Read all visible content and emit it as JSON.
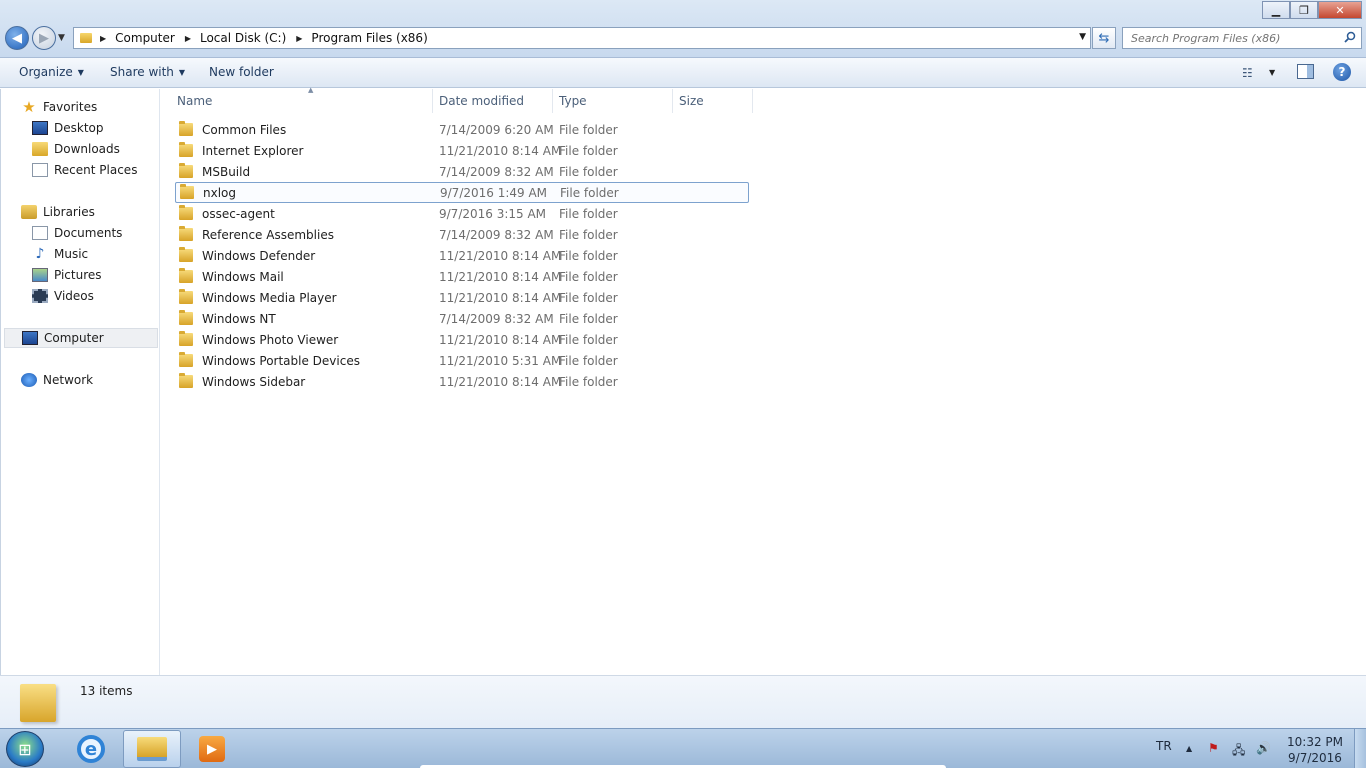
{
  "window": {
    "minimize_label": "▁",
    "maximize_label": "❐",
    "close_label": "✕"
  },
  "address": {
    "crumbs": [
      "Computer",
      "Local Disk (C:)",
      "Program Files (x86)"
    ]
  },
  "search": {
    "placeholder": "Search Program Files (x86)"
  },
  "commands": {
    "organize": "Organize",
    "share_with": "Share with",
    "new_folder": "New folder"
  },
  "sidebar": {
    "favorites": "Favorites",
    "desktop": "Desktop",
    "downloads": "Downloads",
    "recent_places": "Recent Places",
    "libraries": "Libraries",
    "documents": "Documents",
    "music": "Music",
    "pictures": "Pictures",
    "videos": "Videos",
    "computer": "Computer",
    "network": "Network"
  },
  "columns": {
    "name": "Name",
    "date_modified": "Date modified",
    "type": "Type",
    "size": "Size"
  },
  "files": [
    {
      "name": "Common Files",
      "date": "7/14/2009 6:20 AM",
      "type": "File folder"
    },
    {
      "name": "Internet Explorer",
      "date": "11/21/2010 8:14 AM",
      "type": "File folder"
    },
    {
      "name": "MSBuild",
      "date": "7/14/2009 8:32 AM",
      "type": "File folder"
    },
    {
      "name": "nxlog",
      "date": "9/7/2016 1:49 AM",
      "type": "File folder"
    },
    {
      "name": "ossec-agent",
      "date": "9/7/2016 3:15 AM",
      "type": "File folder"
    },
    {
      "name": "Reference Assemblies",
      "date": "7/14/2009 8:32 AM",
      "type": "File folder"
    },
    {
      "name": "Windows Defender",
      "date": "11/21/2010 8:14 AM",
      "type": "File folder"
    },
    {
      "name": "Windows Mail",
      "date": "11/21/2010 8:14 AM",
      "type": "File folder"
    },
    {
      "name": "Windows Media Player",
      "date": "11/21/2010 8:14 AM",
      "type": "File folder"
    },
    {
      "name": "Windows NT",
      "date": "7/14/2009 8:32 AM",
      "type": "File folder"
    },
    {
      "name": "Windows Photo Viewer",
      "date": "11/21/2010 8:14 AM",
      "type": "File folder"
    },
    {
      "name": "Windows Portable Devices",
      "date": "11/21/2010 5:31 AM",
      "type": "File folder"
    },
    {
      "name": "Windows Sidebar",
      "date": "11/21/2010 8:14 AM",
      "type": "File folder"
    }
  ],
  "details": {
    "item_count": "13 items"
  },
  "taskbar": {
    "language": "TR",
    "time": "10:32 PM",
    "date": "9/7/2016"
  }
}
